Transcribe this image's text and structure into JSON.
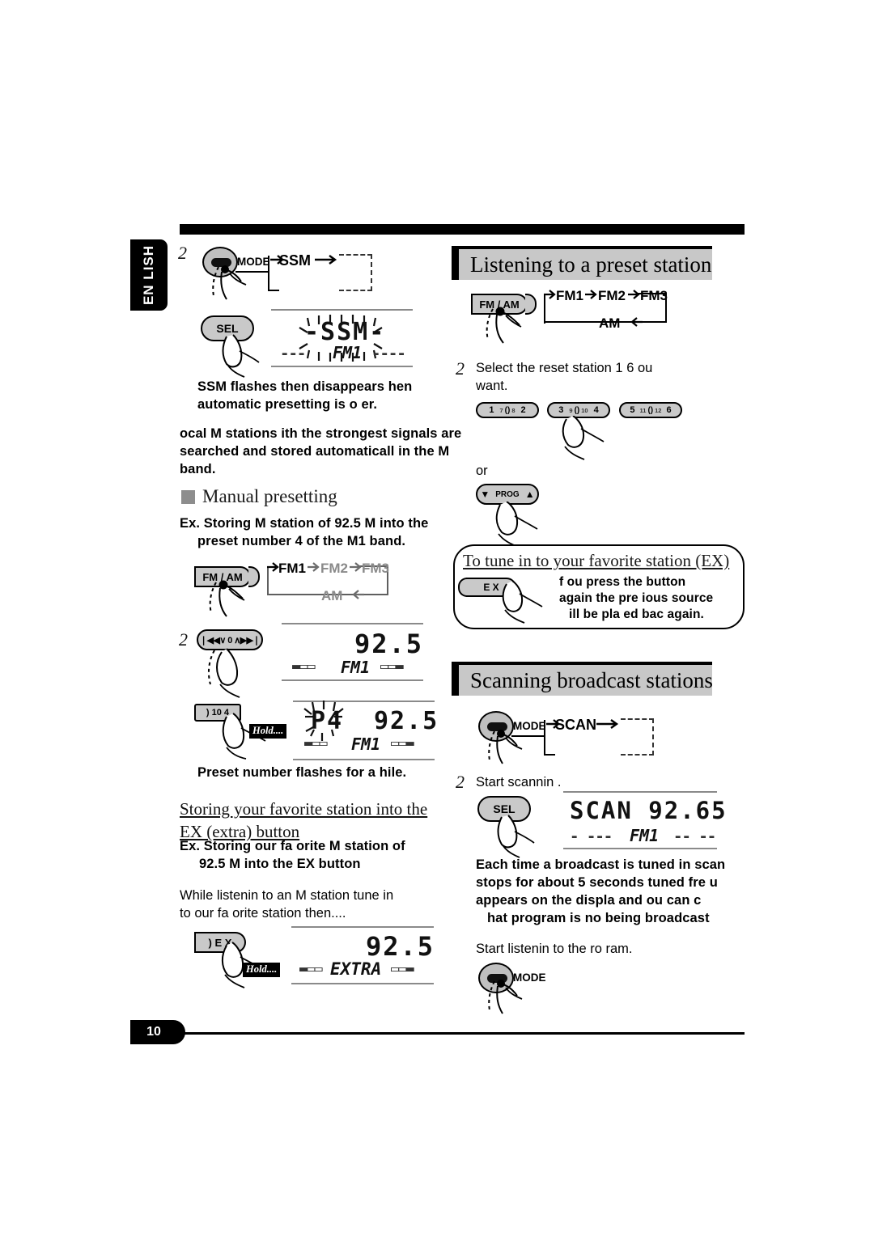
{
  "document": {
    "language_tab": "EN LISH",
    "page_number": "10"
  },
  "left_column": {
    "step2_ssm": {
      "step_number": "2",
      "button_label": "MODE",
      "flow_label": "SSM",
      "sel_button": "SEL",
      "display": {
        "main": "-SSM-",
        "band": "FM1",
        "left_dashes": "---",
        "right_dashes": "----"
      },
      "caption_lines": [
        "SSM flashes  then disappears    hen",
        "automatic presetting is o er."
      ]
    },
    "ssm_note_lines": [
      " ocal  M stations   ith the strongest signals are",
      "searched and stored automaticall  in the  M",
      "band."
    ],
    "manual_presetting": {
      "heading": "Manual presetting",
      "example_lines": [
        "Ex.  Storing  M station of 92.5 M    into the",
        "preset number 4 of the  M1 band."
      ],
      "band_button": "FM / AM",
      "band_flow": [
        "FM1",
        "FM2",
        "FM3",
        "AM"
      ],
      "step_number": "2",
      "tuner_button": "❘◀◀∨ 0 ∧▶▶❘",
      "display_tune": {
        "frequency": "92.5",
        "band": "FM1"
      },
      "preset_button": ")  10    4",
      "hold_label": "Hold....",
      "display_preset": {
        "preset": "P4",
        "frequency": "92.5",
        "band": "FM1"
      },
      "caption": "Preset number flashes for a   hile."
    },
    "ex_section": {
      "heading_lines": [
        "Storing your favorite station into the",
        "EX (extra) button"
      ],
      "example_lines": [
        "Ex.  Storing  our fa orite  M station of",
        "92.5 M     into the EX button"
      ],
      "body_lines": [
        "While listenin  to an  M station  tune in",
        "to  our fa orite station  then...."
      ],
      "ex_button": ")    E X",
      "hold_label": "Hold....",
      "display": {
        "frequency": "92.5",
        "band": "EXTRA"
      }
    }
  },
  "right_column": {
    "preset_section": {
      "title": "Listening to a preset station",
      "band_button": "FM / AM",
      "band_flow": [
        "FM1",
        "FM2",
        "FM3",
        "AM"
      ],
      "step_number": "2",
      "instruction_lines": [
        "Select the  reset station  1  6   ou",
        "want."
      ],
      "preset_buttons": [
        {
          "left": "1",
          "mid_left": "7",
          "mid_right": "8",
          "right": "2"
        },
        {
          "left": "3",
          "mid_left": "9",
          "mid_right": "10",
          "right": "4"
        },
        {
          "left": "5",
          "mid_left": "11",
          "mid_right": "12",
          "right": "6"
        }
      ],
      "or_label": "or",
      "prog_button": "PROG"
    },
    "ex_note": {
      "heading": "To tune in to your favorite station (EX)",
      "button_label": "E X",
      "lines": [
        "f  ou press the button",
        "again  the pre ious source",
        " ill be pla ed bac  again."
      ]
    },
    "scan_section": {
      "title": "Scanning broadcast stations",
      "mode_label": "MODE",
      "flow_label": "SCAN",
      "step_number": "2",
      "step_text": "Start scannin .",
      "sel_button": "SEL",
      "display": {
        "main": "SCAN 92.65",
        "band": "FM1",
        "left_dashes": "-  ---",
        "right_dashes": "--  --"
      },
      "caption_lines": [
        "Each time a broadcast is tuned in  scan",
        "stops for about 5 seconds  tuned fre  u",
        "appears on the displa    and   ou can c",
        " hat program is no   being broadcast"
      ],
      "final_step_text": "Start listenin  to the  ro ram.",
      "final_button_label": "MODE"
    }
  },
  "colors": {
    "banner_bg": "#c8c8c8",
    "button_face": "#c9c9c9",
    "ink": "#000000",
    "grey_text": "#7a7a7a"
  }
}
